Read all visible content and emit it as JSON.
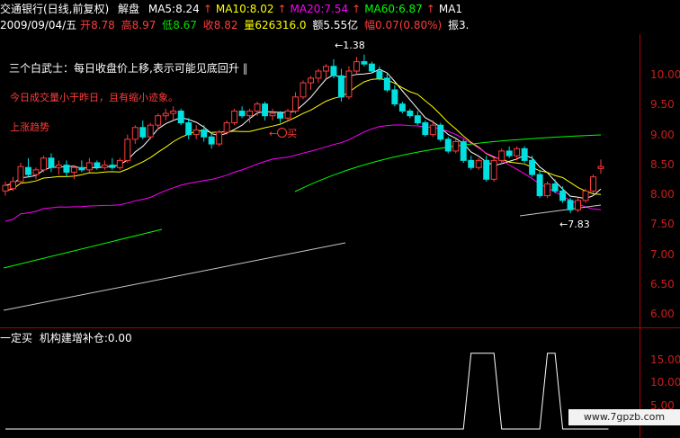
{
  "header": {
    "stock_title": "交通银行(日线,前复权)",
    "view_mode": "解盘",
    "mas": [
      {
        "label": "MA5:8.24",
        "color": "#ffffff"
      },
      {
        "label": "MA10:8.02",
        "color": "#ffff00"
      },
      {
        "label": "MA20:7.54",
        "color": "#ff00ff"
      },
      {
        "label": "MA60:6.87",
        "color": "#00ff00"
      },
      {
        "label": "MA1",
        "color": "#ffffff"
      }
    ],
    "arrow": "↑"
  },
  "quote": {
    "date": "2009/09/04/五",
    "open_label": "开",
    "open": "8.78",
    "high_label": "高",
    "high": "8.97",
    "low_label": "低",
    "low": "8.67",
    "close_label": "收",
    "close": "8.82",
    "volume_label": "量",
    "volume": "626316.0",
    "amount_label": "额",
    "amount": "5.55亿",
    "change_label": "幅",
    "change": "0.07(0.80%)",
    "amplitude_label": "振",
    "amplitude": "3."
  },
  "notes": {
    "three_soldiers": "三个白武士：每日收盘价上移,表示可能见底回升",
    "volume_note": "今日成交量小于昨日，且有缩小迹象。",
    "trend_note": "上涨趋势",
    "buy_marker": "买",
    "high_marker": "1.38",
    "low_marker": "7.83"
  },
  "lower_pane": {
    "title": "一定买",
    "indicator": "机构建增补仓:0.00"
  },
  "watermark": "www.7gpzb.com",
  "colors": {
    "up": "#ff3c3c",
    "down": "#00e0e0",
    "axis": "#c81e1e",
    "ma5": "#ffffff",
    "ma10": "#ffff00",
    "ma20": "#ff00ff",
    "ma60": "#00ff00",
    "ma120": "#c8c8c8"
  },
  "chart_data": [
    {
      "type": "candlestick",
      "ylim": [
        5.8,
        10.4
      ],
      "yticks": [
        "10.00",
        "9.50",
        "9.00",
        "8.50",
        "8.00",
        "7.50",
        "7.00",
        "6.50",
        "6.00"
      ],
      "candles": [
        {
          "o": 8.3,
          "h": 8.5,
          "l": 8.2,
          "c": 8.42
        },
        {
          "o": 8.35,
          "h": 8.6,
          "l": 8.3,
          "c": 8.5
        },
        {
          "o": 8.5,
          "h": 8.9,
          "l": 8.45,
          "c": 8.82
        },
        {
          "o": 8.8,
          "h": 9.0,
          "l": 8.6,
          "c": 8.65
        },
        {
          "o": 8.65,
          "h": 8.8,
          "l": 8.55,
          "c": 8.75
        },
        {
          "o": 8.75,
          "h": 9.05,
          "l": 8.7,
          "c": 9.0
        },
        {
          "o": 9.0,
          "h": 9.1,
          "l": 8.7,
          "c": 8.8
        },
        {
          "o": 8.8,
          "h": 8.95,
          "l": 8.65,
          "c": 8.85
        },
        {
          "o": 8.85,
          "h": 8.95,
          "l": 8.6,
          "c": 8.7
        },
        {
          "o": 8.7,
          "h": 8.85,
          "l": 8.55,
          "c": 8.8
        },
        {
          "o": 8.8,
          "h": 8.95,
          "l": 8.7,
          "c": 8.75
        },
        {
          "o": 8.75,
          "h": 9.0,
          "l": 8.7,
          "c": 8.9
        },
        {
          "o": 8.9,
          "h": 8.95,
          "l": 8.75,
          "c": 8.8
        },
        {
          "o": 8.8,
          "h": 8.95,
          "l": 8.75,
          "c": 8.85
        },
        {
          "o": 8.85,
          "h": 9.0,
          "l": 8.75,
          "c": 8.8
        },
        {
          "o": 8.8,
          "h": 9.0,
          "l": 8.75,
          "c": 8.95
        },
        {
          "o": 8.95,
          "h": 9.5,
          "l": 8.9,
          "c": 9.4
        },
        {
          "o": 9.4,
          "h": 9.7,
          "l": 9.3,
          "c": 9.65
        },
        {
          "o": 9.65,
          "h": 9.8,
          "l": 9.4,
          "c": 9.45
        },
        {
          "o": 9.45,
          "h": 9.75,
          "l": 9.4,
          "c": 9.7
        },
        {
          "o": 9.7,
          "h": 9.95,
          "l": 9.6,
          "c": 9.9
        },
        {
          "o": 9.9,
          "h": 10.05,
          "l": 9.8,
          "c": 9.95
        },
        {
          "o": 9.95,
          "h": 10.1,
          "l": 9.8,
          "c": 10.0
        },
        {
          "o": 10.0,
          "h": 10.05,
          "l": 9.7,
          "c": 9.75
        },
        {
          "o": 9.75,
          "h": 9.85,
          "l": 9.4,
          "c": 9.5
        },
        {
          "o": 9.5,
          "h": 9.7,
          "l": 9.4,
          "c": 9.6
        },
        {
          "o": 9.6,
          "h": 9.7,
          "l": 9.35,
          "c": 9.45
        },
        {
          "o": 9.45,
          "h": 9.55,
          "l": 9.2,
          "c": 9.3
        },
        {
          "o": 9.3,
          "h": 9.6,
          "l": 9.25,
          "c": 9.55
        },
        {
          "o": 9.55,
          "h": 9.8,
          "l": 9.5,
          "c": 9.75
        },
        {
          "o": 9.75,
          "h": 10.05,
          "l": 9.7,
          "c": 10.0
        },
        {
          "o": 10.0,
          "h": 10.1,
          "l": 9.85,
          "c": 9.9
        },
        {
          "o": 9.9,
          "h": 10.05,
          "l": 9.75,
          "c": 10.0
        },
        {
          "o": 10.0,
          "h": 10.2,
          "l": 9.9,
          "c": 10.15
        },
        {
          "o": 10.15,
          "h": 10.2,
          "l": 9.8,
          "c": 9.9
        },
        {
          "o": 9.9,
          "h": 10.05,
          "l": 9.8,
          "c": 9.95
        },
        {
          "o": 9.95,
          "h": 10.0,
          "l": 9.75,
          "c": 9.85
        },
        {
          "o": 9.85,
          "h": 10.05,
          "l": 9.8,
          "c": 10.0
        },
        {
          "o": 10.0,
          "h": 10.4,
          "l": 9.95,
          "c": 10.3
        },
        {
          "o": 10.3,
          "h": 10.65,
          "l": 10.25,
          "c": 10.6
        },
        {
          "o": 10.6,
          "h": 10.75,
          "l": 10.45,
          "c": 10.7
        },
        {
          "o": 10.7,
          "h": 10.9,
          "l": 10.6,
          "c": 10.85
        },
        {
          "o": 10.85,
          "h": 11.0,
          "l": 10.7,
          "c": 10.95
        },
        {
          "o": 10.95,
          "h": 11.1,
          "l": 10.7,
          "c": 10.75
        },
        {
          "o": 10.75,
          "h": 10.9,
          "l": 10.2,
          "c": 10.3
        },
        {
          "o": 10.3,
          "h": 10.95,
          "l": 10.25,
          "c": 10.85
        },
        {
          "o": 10.85,
          "h": 11.15,
          "l": 10.8,
          "c": 11.05
        },
        {
          "o": 11.05,
          "h": 11.2,
          "l": 10.95,
          "c": 11.0
        },
        {
          "o": 11.0,
          "h": 11.05,
          "l": 10.8,
          "c": 10.85
        },
        {
          "o": 10.85,
          "h": 10.95,
          "l": 10.65,
          "c": 10.7
        },
        {
          "o": 10.7,
          "h": 10.8,
          "l": 10.4,
          "c": 10.45
        },
        {
          "o": 10.45,
          "h": 10.55,
          "l": 10.1,
          "c": 10.15
        },
        {
          "o": 10.15,
          "h": 10.2,
          "l": 9.95,
          "c": 10.0
        },
        {
          "o": 10.0,
          "h": 10.05,
          "l": 9.85,
          "c": 9.9
        },
        {
          "o": 9.9,
          "h": 10.0,
          "l": 9.7,
          "c": 9.75
        },
        {
          "o": 9.75,
          "h": 9.8,
          "l": 9.45,
          "c": 9.5
        },
        {
          "o": 9.5,
          "h": 9.8,
          "l": 9.45,
          "c": 9.7
        },
        {
          "o": 9.7,
          "h": 9.75,
          "l": 9.35,
          "c": 9.4
        },
        {
          "o": 9.4,
          "h": 9.45,
          "l": 9.1,
          "c": 9.15
        },
        {
          "o": 9.15,
          "h": 9.4,
          "l": 9.1,
          "c": 9.35
        },
        {
          "o": 9.35,
          "h": 9.4,
          "l": 8.9,
          "c": 8.95
        },
        {
          "o": 8.95,
          "h": 9.05,
          "l": 8.75,
          "c": 8.8
        },
        {
          "o": 8.8,
          "h": 9.0,
          "l": 8.75,
          "c": 8.95
        },
        {
          "o": 8.95,
          "h": 9.05,
          "l": 8.5,
          "c": 8.55
        },
        {
          "o": 8.55,
          "h": 9.0,
          "l": 8.5,
          "c": 8.95
        },
        {
          "o": 8.95,
          "h": 9.2,
          "l": 8.9,
          "c": 9.15
        },
        {
          "o": 9.15,
          "h": 9.25,
          "l": 9.0,
          "c": 9.05
        },
        {
          "o": 9.05,
          "h": 9.25,
          "l": 8.95,
          "c": 9.2
        },
        {
          "o": 9.2,
          "h": 9.25,
          "l": 8.9,
          "c": 8.95
        },
        {
          "o": 8.95,
          "h": 9.05,
          "l": 8.6,
          "c": 8.65
        },
        {
          "o": 8.65,
          "h": 8.75,
          "l": 8.15,
          "c": 8.2
        },
        {
          "o": 8.2,
          "h": 8.5,
          "l": 8.15,
          "c": 8.45
        },
        {
          "o": 8.45,
          "h": 8.55,
          "l": 8.25,
          "c": 8.3
        },
        {
          "o": 8.3,
          "h": 8.4,
          "l": 8.05,
          "c": 8.1
        },
        {
          "o": 8.1,
          "h": 8.15,
          "l": 7.83,
          "c": 7.9
        },
        {
          "o": 7.9,
          "h": 8.15,
          "l": 7.85,
          "c": 8.1
        },
        {
          "o": 8.1,
          "h": 8.35,
          "l": 8.05,
          "c": 8.3
        },
        {
          "o": 8.3,
          "h": 8.65,
          "l": 8.25,
          "c": 8.6
        },
        {
          "o": 8.78,
          "h": 8.97,
          "l": 8.67,
          "c": 8.82
        }
      ]
    },
    {
      "type": "line",
      "name": "机构建增补仓",
      "ylim": [
        0,
        20
      ],
      "yticks": [
        "15.00",
        "10.00",
        "5.00"
      ],
      "values": [
        0,
        0,
        0,
        0,
        0,
        0,
        0,
        0,
        0,
        0,
        0,
        0,
        0,
        0,
        0,
        0,
        0,
        0,
        0,
        0,
        0,
        0,
        0,
        0,
        0,
        0,
        0,
        0,
        0,
        0,
        0,
        0,
        0,
        0,
        0,
        0,
        0,
        0,
        0,
        0,
        0,
        0,
        0,
        0,
        0,
        0,
        0,
        0,
        0,
        0,
        0,
        0,
        0,
        0,
        0,
        0,
        0,
        0,
        0,
        0,
        0,
        16.5,
        16.5,
        16.5,
        16.5,
        0,
        0,
        0,
        0,
        0,
        0,
        16.5,
        16.5,
        0,
        0,
        0,
        0,
        0,
        0,
        0
      ]
    }
  ]
}
